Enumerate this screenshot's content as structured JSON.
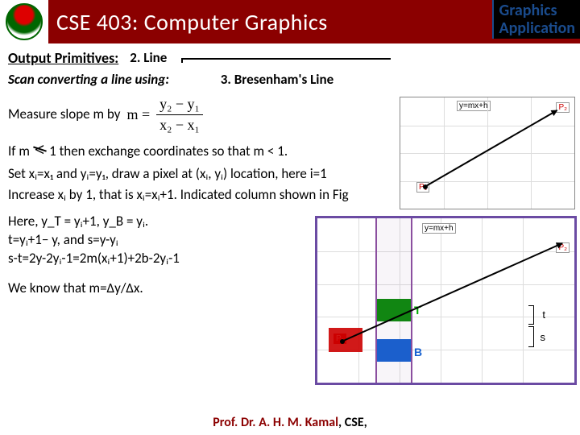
{
  "header": {
    "course_title": "CSE 403: Computer Graphics",
    "badge_l1": "Graphics",
    "badge_l2": "Application"
  },
  "sec": {
    "output_prim": "Output Primitives:",
    "item": "2. Line",
    "scan": "Scan converting a line using:",
    "method": "3. Bresenham's Line"
  },
  "body": {
    "measure": "Measure slope m by",
    "slope_top": "y₂ − y₁",
    "slope_bot": "x₂ − x₁",
    "m_eq": "m =",
    "ifm_pre": "If m",
    "ifm_post": " 1  then exchange coordinates so that m < 1.",
    "lt": "<",
    "setxi": "Set xᵢ=x₁ and yᵢ=y₁, draw a pixel at (xᵢ, yᵢ) location, here i=1",
    "increase": "Increase xᵢ by 1, that is xᵢ=xᵢ+1. Indicated column shown in Fig",
    "here1": "Here, y_T = yᵢ+1, y_B = yᵢ.",
    "here2": "t=yᵢ+1− y, and s=y-yᵢ",
    "here3": "s-t=2y-2yᵢ-1=2m(xᵢ+1)+2b-2yᵢ-1",
    "weknow": "We know that m=∆y/∆x."
  },
  "fig": {
    "eq": "y=mx+h",
    "p1": "P₁",
    "p2": "P₂",
    "T": "T",
    "B": "B",
    "t": "t",
    "s": "s"
  },
  "footer": {
    "prof": "Prof. Dr. A. H. M. Kamal",
    "dept": ", CSE,"
  }
}
